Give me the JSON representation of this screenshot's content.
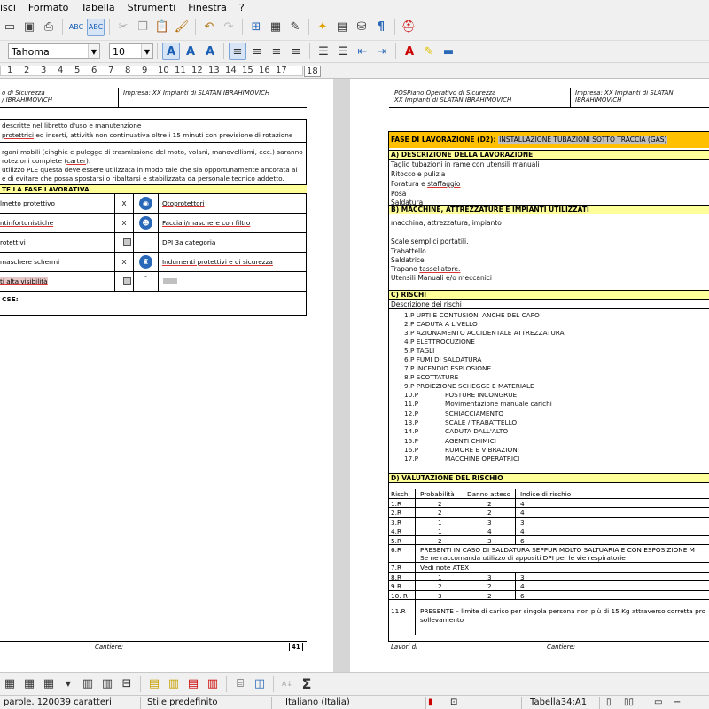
{
  "menu": {
    "items": [
      "isci",
      "Formato",
      "Tabella",
      "Strumenti",
      "Finestra",
      "?"
    ]
  },
  "toolbar": {
    "font_name": "Tahoma",
    "font_size": "10"
  },
  "ruler": {
    "ticks": [
      "1",
      "2",
      "3",
      "4",
      "5",
      "6",
      "7",
      "8",
      "9",
      "10",
      "11",
      "12",
      "13",
      "14",
      "15",
      "16",
      "17",
      "18"
    ]
  },
  "left_page": {
    "header_left_1": "o di Sicurezza",
    "header_left_2": "/ IBRAHIMOVICH",
    "header_right": "Impresa: XX Impianti di SLATAN IBRAHIMOVICH",
    "line1": "descritte nel libretto d'uso e manutenzione",
    "line2a": "protettrici",
    "line2b": " ed inserti, attività non continuativa oltre i 15 minuti con previsione di rotazione",
    "line3": "rgani mobili (cinghie e pulegge di trasmissione del moto, volani, manovellismi, ecc.) saranno",
    "line4a": "rotezioni complete (",
    "line4b": "carter",
    "line4c": ").",
    "line5": "utilizzo PLE questa deve essere utilizzata in modo tale che sia opportunamente ancorata al",
    "line6": "e di evitare che possa spostarsi o ribaltarsi e stabilizzata da personale tecnico addetto.",
    "section_title": "TE LA FASE LAVORATIVA",
    "dpi": [
      {
        "left": "lmetto protettivo",
        "mark": "X",
        "right": "Otoprotettori"
      },
      {
        "left": "ntinfortunistiche",
        "mark": "X",
        "right": "Facciali/maschere con filtro"
      },
      {
        "left": "rotettivi",
        "mark": "",
        "right": "DPI 3a categoria"
      },
      {
        "left": " maschere schermi",
        "mark": "X",
        "right": "Indumenti protettivi e di sicurezza"
      },
      {
        "left": "ti alta visibilità",
        "mark": "",
        "right": "-"
      }
    ],
    "cse_label": "CSE:",
    "footer_cantiere": "Cantiere:",
    "page_number": "41"
  },
  "right_page": {
    "header_left_1": "POSPiano Operativo di Sicurezza",
    "header_left_2": "XX Impianti di SLATAN IBRAHIMOVICH",
    "header_right": "Impresa: XX Impianti di SLATAN IBRAHIMOVICH",
    "fase_label": "FASE DI LAVORAZIONE (D2):",
    "fase_value": "INSTALLAZIONE TUBAZIONI SOTTO TRACCIA (GAS)",
    "section_a": "A)  DESCRIZIONE DELLA LAVORAZIONE",
    "desc_lines": [
      "Taglio tubazioni in rame con utensili manuali",
      "Ritocco e pulizia",
      "Foratura e staffaggio",
      "Posa",
      "Saldatura"
    ],
    "section_b": "B)  MACCHINE, ATTREZZATURE E IMPIANTI UTILIZZATI",
    "mach_header": "macchina, attrezzatura, impianto",
    "mach_lines": [
      "Scale semplici portatili.",
      "Trabattello.",
      "Saldatrice",
      "Trapano tassellatore.",
      "Utensili Manuali e/o meccanici"
    ],
    "section_c": "C)  RISCHI",
    "risk_header": "Descrizione dei rischi",
    "risks": [
      {
        "code": "1.P",
        "text": "URTI E CONTUSIONI ANCHE DEL CAPO"
      },
      {
        "code": "2.P",
        "text": "CADUTA A LIVELLO"
      },
      {
        "code": "3.P",
        "text": "AZIONAMENTO ACCIDENTALE ATTREZZATURA"
      },
      {
        "code": "4.P",
        "text": "ELETTROCUZIONE"
      },
      {
        "code": "5.P",
        "text": "TAGLI"
      },
      {
        "code": "6.P",
        "text": "FUMI DI SALDATURA"
      },
      {
        "code": "7.P",
        "text": "INCENDIO ESPLOSIONE"
      },
      {
        "code": "8.P",
        "text": "SCOTTATURE"
      },
      {
        "code": "9.P",
        "text": "PROIEZIONE SCHEGGE E MATERIALE"
      },
      {
        "code": "10.P",
        "text": "POSTURE INCONGRUE"
      },
      {
        "code": "11.P",
        "text": "Movimentazione manuale carichi"
      },
      {
        "code": "12.P",
        "text": "SCHIACCIAMENTO"
      },
      {
        "code": "13.P",
        "text": "SCALE / TRABATTELLO"
      },
      {
        "code": "14.P",
        "text": "CADUTA DALL'ALTO"
      },
      {
        "code": "15.P",
        "text": "AGENTI CHIMICI"
      },
      {
        "code": "16.P",
        "text": "RUMORE E VIBRAZIONI"
      },
      {
        "code": "17.P",
        "text": "MACCHINE OPERATRICI"
      }
    ],
    "section_d": "D)  VALUTAZIONE DEL RISCHIO",
    "val_headers": [
      "Rischi",
      "Probabilità",
      "Danno atteso",
      "Indice di rischio"
    ],
    "val_rows": [
      {
        "r": "1.R",
        "p": "2",
        "d": "2",
        "i": "4"
      },
      {
        "r": "2.R",
        "p": "2",
        "d": "2",
        "i": "4"
      },
      {
        "r": "3.R",
        "p": "1",
        "d": "3",
        "i": "3"
      },
      {
        "r": "4.R",
        "p": "1",
        "d": "4",
        "i": "4"
      },
      {
        "r": "5.R",
        "p": "2",
        "d": "3",
        "i": "6"
      }
    ],
    "row6_code": "6.R",
    "row6_line1": "PRESENTI IN CASO DI SALDATURA SEPPUR MOLTO SALTUARIA E CON ESPOSIZIONE M",
    "row6_line2": "Se ne raccomanda utilizzo di appositi DPI per le vie respiratorie",
    "row7_code": "7.R",
    "row7_text": "Vedi note ATEX",
    "val_rows2": [
      {
        "r": "8.R",
        "p": "1",
        "d": "3",
        "i": "3"
      },
      {
        "r": "9.R",
        "p": "2",
        "d": "2",
        "i": "4"
      },
      {
        "r": "10. R",
        "p": "3",
        "d": "2",
        "i": "6"
      }
    ],
    "row11_code": "11.R",
    "row11_line1": "PRESENTE – limite di carico per singola persona non più di 15 Kg attraverso corretta pro",
    "row11_line2": "sollevamento",
    "footer_lavori": "Lavori di",
    "footer_cantiere": "Cantiere:"
  },
  "status": {
    "words": "parole, 120039 caratteri",
    "style": "Stile predefinito",
    "language": "Italiano (Italia)",
    "table": "Tabella34:A1"
  }
}
